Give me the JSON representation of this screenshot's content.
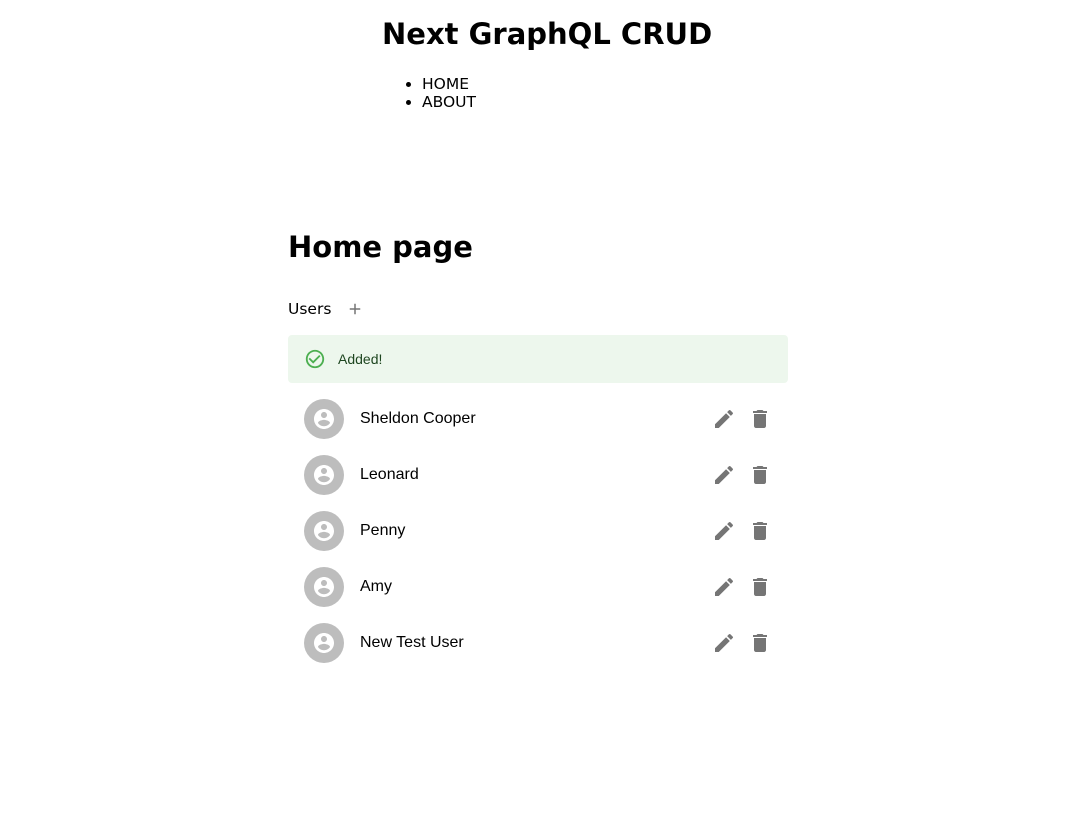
{
  "header": {
    "title": "Next GraphQL CRUD",
    "nav": [
      {
        "label": "HOME"
      },
      {
        "label": "ABOUT"
      }
    ]
  },
  "main": {
    "title": "Home page",
    "users_label": "Users",
    "alert": {
      "message": "Added!",
      "severity": "success",
      "icon": "check-circle-outline-icon"
    },
    "users": [
      {
        "name": "Sheldon Cooper"
      },
      {
        "name": "Leonard"
      },
      {
        "name": "Penny"
      },
      {
        "name": "Amy"
      },
      {
        "name": "New Test User"
      }
    ]
  },
  "colors": {
    "alert_background": "#edf7ed",
    "alert_icon": "#4caf50",
    "alert_text": "#1e4620",
    "avatar_background": "#bdbdbd",
    "action_icon": "#757575"
  }
}
